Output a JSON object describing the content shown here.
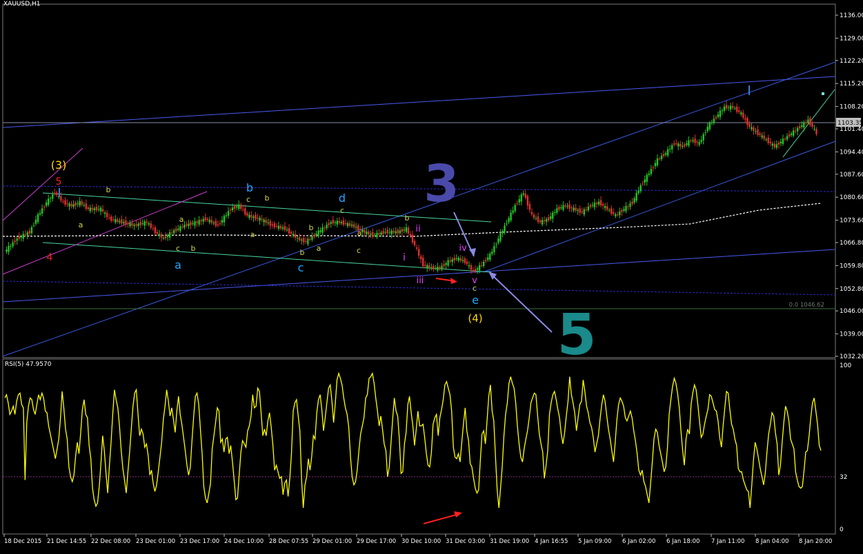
{
  "window": {
    "symbol_label": "XAUUSD,H1"
  },
  "indicator": {
    "label": "RSI(5) 47.9570"
  },
  "chart_data": [
    {
      "type": "candlestick",
      "title": "XAUUSD,H1",
      "ylim": [
        1032.2,
        1136.0
      ],
      "y_ticks": [
        "1136.00",
        "1129.00",
        "1122.20",
        "1115.20",
        "1108.20",
        "1101.40",
        "1094.40",
        "1087.60",
        "1080.60",
        "1073.60",
        "1066.80",
        "1059.80",
        "1052.80",
        "1046.00",
        "1039.00",
        "1032.20"
      ],
      "current_price": "1103.35",
      "fib_level": "0.0 1046.62",
      "x_ticks": [
        "18 Dec 2015",
        "21 Dec 14:55",
        "22 Dec 08:00",
        "23 Dec 01:00",
        "23 Dec 17:00",
        "24 Dec 10:00",
        "28 Dec 07:55",
        "29 Dec 01:00",
        "29 Dec 17:00",
        "30 Dec 10:00",
        "31 Dec 03:00",
        "31 Dec 19:00",
        "4 Jan 16:55",
        "5 Jan 09:00",
        "6 Jan 02:00",
        "6 Jan 18:00",
        "7 Jan 11:00",
        "8 Jan 04:00",
        "8 Jan 20:00"
      ],
      "price_path": [
        [
          0,
          1064
        ],
        [
          3,
          1068
        ],
        [
          6,
          1070
        ],
        [
          8,
          1075
        ],
        [
          10,
          1079
        ],
        [
          12,
          1082
        ],
        [
          14,
          1079
        ],
        [
          16,
          1078
        ],
        [
          18,
          1079
        ],
        [
          20,
          1077
        ],
        [
          23,
          1077
        ],
        [
          25,
          1074
        ],
        [
          28,
          1073
        ],
        [
          31,
          1072
        ],
        [
          34,
          1073
        ],
        [
          36,
          1070
        ],
        [
          38,
          1068
        ],
        [
          40,
          1070
        ],
        [
          43,
          1072
        ],
        [
          46,
          1073
        ],
        [
          48,
          1074
        ],
        [
          51,
          1072
        ],
        [
          54,
          1077
        ],
        [
          56,
          1078
        ],
        [
          58,
          1075
        ],
        [
          61,
          1074
        ],
        [
          64,
          1072
        ],
        [
          67,
          1071
        ],
        [
          70,
          1068
        ],
        [
          72,
          1067
        ],
        [
          75,
          1070
        ],
        [
          78,
          1073
        ],
        [
          80,
          1073
        ],
        [
          83,
          1072
        ],
        [
          86,
          1070
        ],
        [
          88,
          1069
        ],
        [
          91,
          1070
        ],
        [
          94,
          1070
        ],
        [
          96,
          1071
        ],
        [
          98,
          1066
        ],
        [
          100,
          1060
        ],
        [
          102,
          1059
        ],
        [
          104,
          1059
        ],
        [
          106,
          1061
        ],
        [
          108,
          1062
        ],
        [
          110,
          1061
        ],
        [
          112,
          1058
        ],
        [
          114,
          1060
        ],
        [
          116,
          1063
        ],
        [
          118,
          1068
        ],
        [
          120,
          1073
        ],
        [
          122,
          1078
        ],
        [
          124,
          1082
        ],
        [
          126,
          1075
        ],
        [
          128,
          1073
        ],
        [
          130,
          1074
        ],
        [
          132,
          1077
        ],
        [
          134,
          1078
        ],
        [
          136,
          1077
        ],
        [
          138,
          1076
        ],
        [
          140,
          1078
        ],
        [
          142,
          1079
        ],
        [
          144,
          1077
        ],
        [
          146,
          1075
        ],
        [
          148,
          1077
        ],
        [
          150,
          1079
        ],
        [
          152,
          1084
        ],
        [
          154,
          1088
        ],
        [
          156,
          1092
        ],
        [
          158,
          1094
        ],
        [
          160,
          1097
        ],
        [
          162,
          1096
        ],
        [
          164,
          1098
        ],
        [
          166,
          1097
        ],
        [
          168,
          1102
        ],
        [
          170,
          1105
        ],
        [
          172,
          1108
        ],
        [
          174,
          1108
        ],
        [
          176,
          1106
        ],
        [
          178,
          1102
        ],
        [
          180,
          1100
        ],
        [
          182,
          1098
        ],
        [
          184,
          1096
        ],
        [
          186,
          1098
        ],
        [
          188,
          1100
        ],
        [
          190,
          1102
        ],
        [
          192,
          1104
        ],
        [
          194,
          1100
        ]
      ],
      "annotations": [
        {
          "text": "(3)",
          "color": "#FFD700"
        },
        {
          "text": "5",
          "color": "#FF2020"
        },
        {
          "text": "4",
          "color": "#FF2020"
        },
        {
          "text": "b",
          "color": "#D4D44A"
        },
        {
          "text": "a",
          "color": "#D4D44A"
        },
        {
          "text": "b",
          "color": "#1FA8FF"
        },
        {
          "text": "c",
          "color": "#D4D44A"
        },
        {
          "text": "a",
          "color": "#D4D44A"
        },
        {
          "text": "c",
          "color": "#D4D44A"
        },
        {
          "text": "b",
          "color": "#D4D44A"
        },
        {
          "text": "a",
          "color": "#1FA8FF"
        },
        {
          "text": "b",
          "color": "#D4D44A"
        },
        {
          "text": "a",
          "color": "#D4D44A"
        },
        {
          "text": "d",
          "color": "#1FA8FF"
        },
        {
          "text": "c",
          "color": "#D4D44A"
        },
        {
          "text": "b",
          "color": "#D4D44A"
        },
        {
          "text": "a",
          "color": "#D4D44A"
        },
        {
          "text": "c",
          "color": "#D4D44A"
        },
        {
          "text": "b",
          "color": "#D4D44A"
        },
        {
          "text": "c",
          "color": "#1FA8FF"
        },
        {
          "text": "a",
          "color": "#D4D44A"
        },
        {
          "text": "b",
          "color": "#D4D44A"
        },
        {
          "text": "ii",
          "color": "#E040FB"
        },
        {
          "text": "i",
          "color": "#E040FB"
        },
        {
          "text": "iii",
          "color": "#E040FB"
        },
        {
          "text": "iv",
          "color": "#E040FB"
        },
        {
          "text": "v",
          "color": "#E040FB"
        },
        {
          "text": "c",
          "color": "#D4D44A"
        },
        {
          "text": "e",
          "color": "#1FA8FF"
        },
        {
          "text": "(4)",
          "color": "#FFD700"
        }
      ],
      "handwritten": [
        {
          "text": "3",
          "color": "#4A4AAA"
        },
        {
          "text": "5",
          "color": "#1A8A8A"
        }
      ]
    },
    {
      "type": "line",
      "title": "RSI(5) 47.9570",
      "ylim": [
        0,
        100
      ],
      "y_ticks": [
        "100",
        "32",
        "0"
      ],
      "series": [
        {
          "values": [
            80,
            82,
            77,
            70,
            72,
            75,
            70,
            78,
            82,
            83,
            76,
            74,
            30,
            65,
            75,
            80,
            79,
            73,
            70,
            76,
            82,
            79,
            83,
            80,
            72,
            71,
            63,
            58,
            53,
            48,
            43,
            49,
            55,
            68,
            84,
            74,
            61,
            55,
            38,
            32,
            29,
            33,
            45,
            53,
            46,
            59,
            73,
            79,
            70,
            68,
            51,
            43,
            25,
            18,
            14,
            16,
            26,
            40,
            57,
            48,
            34,
            22,
            38,
            53,
            70,
            85,
            79,
            74,
            63,
            48,
            37,
            30,
            22,
            35,
            47,
            61,
            75,
            83,
            85,
            70,
            57,
            61,
            58,
            50,
            52,
            45,
            33,
            36,
            28,
            23,
            27,
            35,
            44,
            53,
            67,
            75,
            85,
            78,
            69,
            74,
            67,
            59,
            72,
            81,
            70,
            64,
            56,
            48,
            39,
            33,
            38,
            54,
            69,
            81,
            83,
            76,
            61,
            46,
            26,
            19,
            16,
            22,
            28,
            49,
            57,
            65,
            74,
            72,
            53,
            55,
            47,
            55,
            56,
            46,
            51,
            41,
            30,
            18,
            19,
            33,
            47,
            54,
            52,
            50,
            60,
            63,
            69,
            82,
            74,
            75,
            86,
            84,
            71,
            57,
            61,
            57,
            66,
            71,
            62,
            51,
            36,
            39,
            35,
            31,
            32,
            21,
            28,
            30,
            20,
            31,
            46,
            72,
            77,
            79,
            69,
            60,
            30,
            13,
            27,
            32,
            43,
            36,
            44,
            57,
            55,
            71,
            79,
            82,
            73,
            60,
            68,
            77,
            86,
            88,
            78,
            65,
            77,
            91,
            95,
            92,
            88,
            80,
            74,
            70,
            62,
            44,
            32,
            27,
            29,
            36,
            48,
            58,
            63,
            68,
            80,
            82,
            92,
            93,
            95,
            89,
            80,
            72,
            63,
            69,
            61,
            52,
            48,
            32,
            38,
            52,
            67,
            80,
            72,
            69,
            55,
            34,
            35,
            52,
            59,
            76,
            81,
            71,
            63,
            51,
            61,
            72,
            63,
            63,
            64,
            56,
            46,
            39,
            38,
            47,
            64,
            68,
            70,
            57,
            68,
            73,
            79,
            88,
            90,
            86,
            82,
            72,
            50,
            44,
            43,
            46,
            41,
            53,
            64,
            74,
            60,
            54,
            40,
            38,
            31,
            25,
            22,
            24,
            42,
            58,
            60,
            52,
            66,
            81,
            88,
            72,
            66,
            44,
            24,
            13,
            25,
            38,
            57,
            70,
            77,
            89,
            93,
            89,
            86,
            77,
            63,
            52,
            44,
            41,
            49,
            55,
            60,
            68,
            77,
            80,
            83,
            82,
            69,
            58,
            52,
            47,
            31,
            39,
            48,
            70,
            77,
            82,
            84,
            79,
            73,
            68,
            58,
            52,
            59,
            69,
            78,
            93,
            82,
            77,
            71,
            60,
            68,
            76,
            78,
            91,
            84,
            75,
            71,
            65,
            62,
            56,
            47,
            52,
            57,
            67,
            76,
            82,
            78,
            69,
            61,
            55,
            48,
            41,
            53,
            67,
            76,
            80,
            78,
            75,
            68,
            66,
            69,
            72,
            68,
            60,
            54,
            46,
            36,
            33,
            36,
            29,
            26,
            21,
            16,
            28,
            41,
            55,
            61,
            59,
            51,
            46,
            41,
            35,
            38,
            50,
            70,
            79,
            87,
            92,
            89,
            83,
            74,
            60,
            48,
            39,
            55,
            61,
            58,
            76,
            83,
            88,
            85,
            76,
            66,
            56,
            58,
            64,
            69,
            73,
            82,
            81,
            77,
            73,
            72,
            66,
            56,
            50,
            63,
            74,
            84,
            83,
            73,
            64,
            61,
            55,
            51,
            37,
            35,
            35,
            30,
            27,
            24,
            23,
            13,
            27,
            42,
            53,
            49,
            43,
            37,
            32,
            27,
            34,
            47,
            58,
            64,
            71,
            69,
            59,
            52,
            33,
            39,
            53,
            65,
            75,
            72,
            66,
            55,
            52,
            49,
            35,
            30,
            26,
            25,
            26,
            36,
            47,
            48,
            57,
            68,
            77,
            80,
            72,
            64,
            51,
            48
          ]
        }
      ]
    }
  ]
}
